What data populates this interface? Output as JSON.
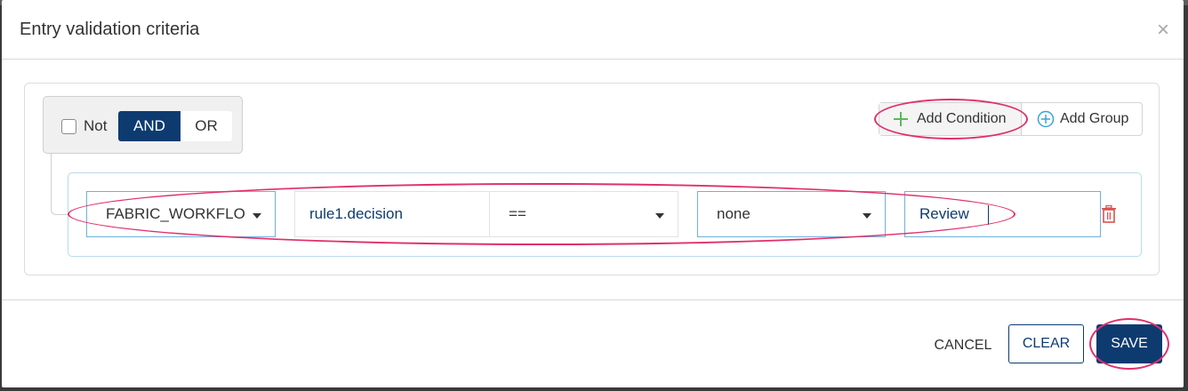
{
  "dialog": {
    "title": "Entry validation criteria",
    "close_glyph": "×"
  },
  "group": {
    "not_label": "Not",
    "not_checked": false,
    "combinators": [
      "AND",
      "OR"
    ],
    "active_combinator": "AND",
    "add_condition_label": "Add Condition",
    "add_group_label": "Add Group"
  },
  "rule": {
    "field": "FABRIC_WORKFLO",
    "expression": "rule1.decision",
    "operator": "==",
    "value_type": "none",
    "value": "Review"
  },
  "footer": {
    "cancel_label": "CANCEL",
    "clear_label": "CLEAR",
    "save_label": "SAVE"
  },
  "colors": {
    "primary": "#0d3b70",
    "add_icon_green": "#5bb85c",
    "add_group_blue": "#3ba4d8",
    "delete_red": "#d9534f",
    "annotation_pink": "#e0306b"
  },
  "icons": [
    "close-icon",
    "plus-icon",
    "circle-plus-icon",
    "chevron-down-icon",
    "trash-icon"
  ]
}
